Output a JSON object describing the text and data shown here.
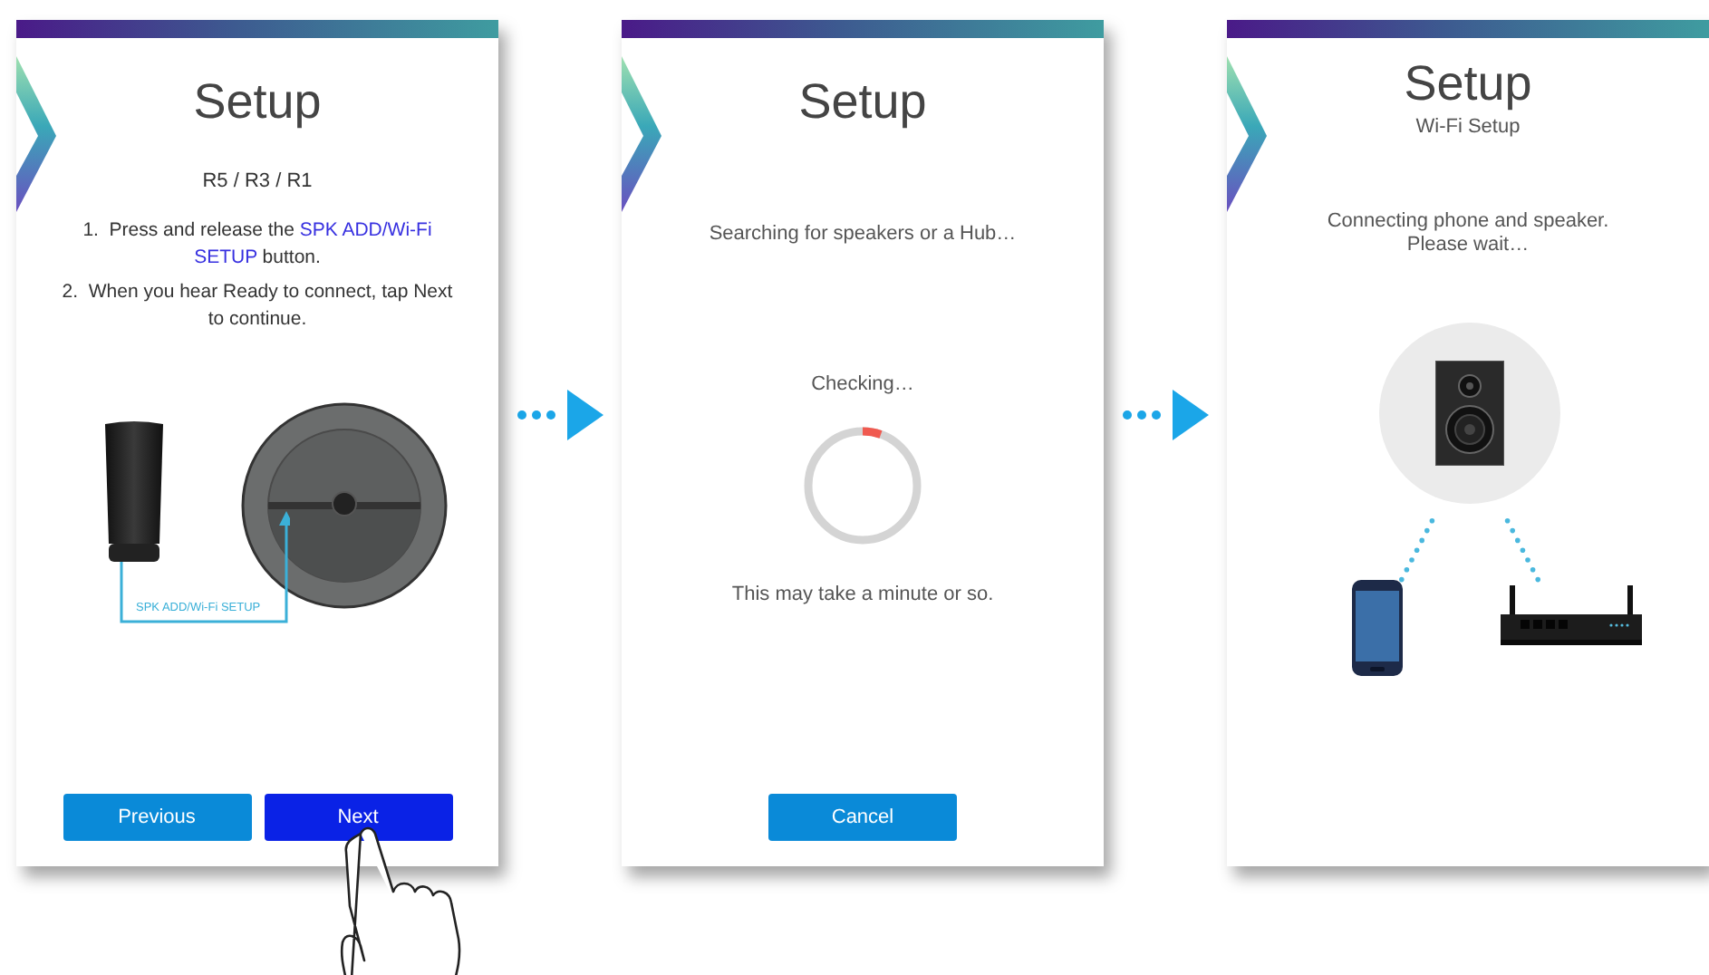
{
  "screens": [
    {
      "kind": "instructions",
      "title": "Setup",
      "model": "R5 / R3 / R1",
      "steps": [
        {
          "number": "1.",
          "parts": [
            {
              "text": "Press and release the ",
              "highlight": false
            },
            {
              "text": "SPK ADD/Wi-Fi SETUP",
              "highlight": true
            },
            {
              "text": " button.",
              "highlight": false
            }
          ]
        },
        {
          "number": "2.",
          "parts": [
            {
              "text": "When you hear Ready to connect, tap Next to continue.",
              "highlight": false
            }
          ]
        }
      ],
      "callout": "SPK ADD/Wi-Fi SETUP",
      "buttons": [
        {
          "label": "Previous",
          "pressed": false
        },
        {
          "label": "Next",
          "pressed": true
        }
      ]
    },
    {
      "kind": "searching",
      "title": "Setup",
      "status": "Searching for speakers or a Hub…",
      "checking": "Checking…",
      "note": "This may take a minute or so.",
      "buttons": [
        {
          "label": "Cancel",
          "pressed": false
        }
      ]
    },
    {
      "kind": "connecting",
      "title": "Setup",
      "subtitle": "Wi-Fi Setup",
      "message": "Connecting phone and speaker.\nPlease wait…"
    }
  ]
}
